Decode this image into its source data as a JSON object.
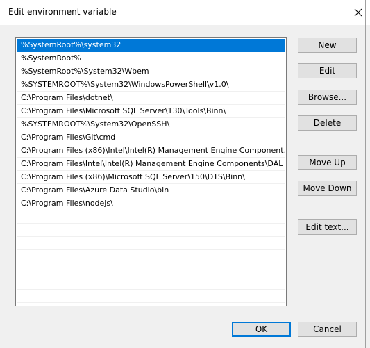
{
  "window": {
    "title": "Edit environment variable",
    "close_icon": "close-icon"
  },
  "list": {
    "items": [
      "%SystemRoot%\\system32",
      "%SystemRoot%",
      "%SystemRoot%\\System32\\Wbem",
      "%SYSTEMROOT%\\System32\\WindowsPowerShell\\v1.0\\",
      "C:\\Program Files\\dotnet\\",
      "C:\\Program Files\\Microsoft SQL Server\\130\\Tools\\Binn\\",
      "%SYSTEMROOT%\\System32\\OpenSSH\\",
      "C:\\Program Files\\Git\\cmd",
      "C:\\Program Files (x86)\\Intel\\Intel(R) Management Engine Component...",
      "C:\\Program Files\\Intel\\Intel(R) Management Engine Components\\DAL",
      "C:\\Program Files (x86)\\Microsoft SQL Server\\150\\DTS\\Binn\\",
      "C:\\Program Files\\Azure Data Studio\\bin",
      "C:\\Program Files\\nodejs\\"
    ],
    "selected_index": 0
  },
  "buttons": {
    "new": "New",
    "edit": "Edit",
    "browse": "Browse...",
    "delete": "Delete",
    "move_up": "Move Up",
    "move_down": "Move Down",
    "edit_text": "Edit text...",
    "ok": "OK",
    "cancel": "Cancel"
  },
  "colors": {
    "selection": "#0078d7",
    "dialog_bg": "#f0f0f0"
  }
}
